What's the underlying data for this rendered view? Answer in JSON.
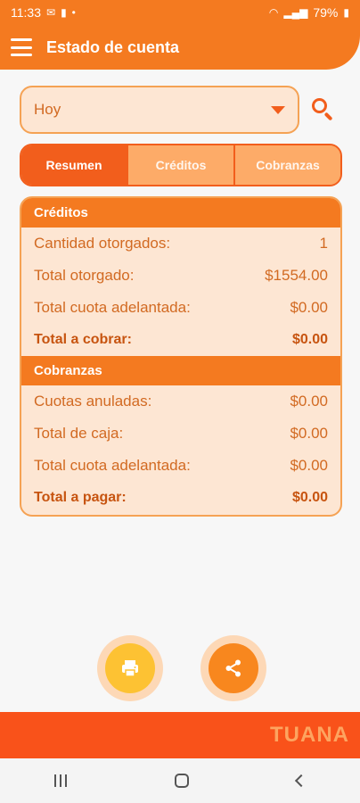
{
  "status_bar": {
    "time": "11:33",
    "battery": "79%"
  },
  "app_bar": {
    "title": "Estado de cuenta"
  },
  "filter": {
    "selected": "Hoy"
  },
  "tabs": [
    {
      "label": "Resumen",
      "active": true
    },
    {
      "label": "Créditos",
      "active": false
    },
    {
      "label": "Cobranzas",
      "active": false
    }
  ],
  "creditos": {
    "title": "Créditos",
    "rows": [
      {
        "label": "Cantidad otorgados:",
        "value": "1"
      },
      {
        "label": "Total otorgado:",
        "value": "$1554.00"
      },
      {
        "label": "Total cuota adelantada:",
        "value": "$0.00"
      }
    ],
    "total": {
      "label": "Total a cobrar:",
      "value": "$0.00"
    }
  },
  "cobranzas": {
    "title": "Cobranzas",
    "rows": [
      {
        "label": "Cuotas anuladas:",
        "value": "$0.00"
      },
      {
        "label": "Total de caja:",
        "value": "$0.00"
      },
      {
        "label": "Total cuota adelantada:",
        "value": "$0.00"
      }
    ],
    "total": {
      "label": "Total a pagar:",
      "value": "$0.00"
    }
  },
  "actions": {
    "print_icon": "printer-icon",
    "share_icon": "share-icon"
  },
  "brand": {
    "name": "TUANA"
  },
  "colors": {
    "primary": "#f47a20",
    "accent": "#f25e1c",
    "card_bg": "#fde6d3",
    "brand_bar": "#f9521a",
    "print_fab": "#fdc233"
  }
}
